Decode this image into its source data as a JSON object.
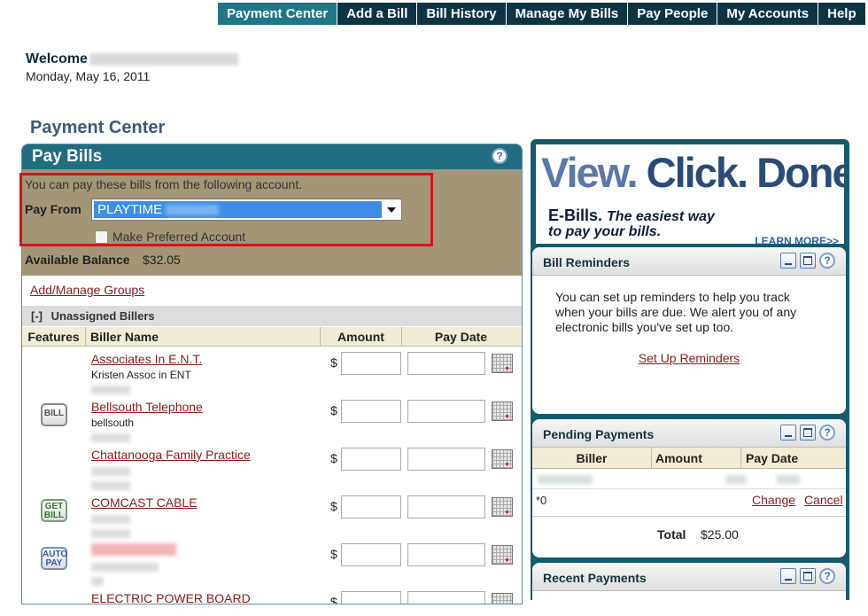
{
  "nav": {
    "items": [
      "Payment Center",
      "Add a Bill",
      "Bill History",
      "Manage My Bills",
      "Pay People",
      "My Accounts",
      "Help"
    ]
  },
  "header": {
    "welcome": "Welcome",
    "date": "Monday, May 16, 2011",
    "page_title": "Payment Center"
  },
  "pay_bills": {
    "title": "Pay Bills",
    "help": "?",
    "account_note": "You can pay these bills from the following account.",
    "pay_from_label": "Pay From",
    "pay_from_value": "PLAYTIME",
    "preferred_label": "Make Preferred Account",
    "balance_label": "Available Balance",
    "balance_value": "$32.05",
    "manage_groups": "Add/Manage Groups",
    "group_toggle": "[-]",
    "group_name": "Unassigned Billers",
    "columns": [
      "Features",
      "Biller Name",
      "Amount",
      "Pay Date"
    ],
    "dollar": "$",
    "billers": [
      {
        "name": "Associates In E.N.T.",
        "sub": "Kristen Assoc in ENT",
        "badge": ""
      },
      {
        "name": "Bellsouth Telephone",
        "sub": "bellsouth",
        "badge": "BILL"
      },
      {
        "name": "Chattanooga Family Practice",
        "sub": "",
        "badge": ""
      },
      {
        "name": "COMCAST CABLE",
        "sub": "",
        "badge": "GET BILL"
      },
      {
        "name": "",
        "sub": "",
        "badge": "AUTO PAY"
      },
      {
        "name": "ELECTRIC POWER BOARD",
        "sub": "",
        "badge": ""
      }
    ]
  },
  "banner": {
    "view": "View.",
    "click": "Click.",
    "done": "Done.",
    "ebills": "E-Bills.",
    "tagline1": "The easiest way",
    "tagline2": "to pay your bills.",
    "learn_more": "LEARN MORE>>"
  },
  "bill_reminders": {
    "title": "Bill Reminders",
    "help": "?",
    "text": "You can set up reminders to help you track when your bills are due. We alert you of any electronic bills you've set up too.",
    "link": "Set Up Reminders"
  },
  "pending_payments": {
    "title": "Pending Payments",
    "help": "?",
    "columns": [
      "Biller",
      "Amount",
      "Pay Date"
    ],
    "footnote": "*0",
    "change": "Change",
    "cancel": "Cancel",
    "total_label": "Total",
    "total_value": "$25.00"
  },
  "recent_payments": {
    "title": "Recent Payments",
    "help": "?"
  },
  "colors": {
    "nav_bg": "#0d3445",
    "nav_active": "#1f7788",
    "panel_header": "#1f6d80",
    "account_bg": "#a39677",
    "link": "#8a1a1a",
    "highlight_box": "#d4141b"
  }
}
